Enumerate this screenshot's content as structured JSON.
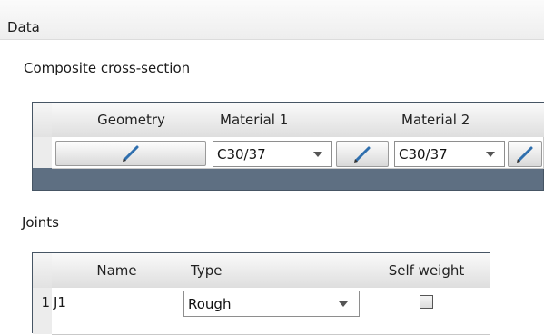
{
  "panel": {
    "title": "Data"
  },
  "composite": {
    "label": "Composite cross-section",
    "headers": {
      "geometry": "Geometry",
      "material1": "Material 1",
      "material2": "Material 2"
    },
    "material1": {
      "value": "C30/37"
    },
    "material2": {
      "value": "C30/37"
    }
  },
  "joints": {
    "label": "Joints",
    "headers": {
      "name": "Name",
      "type": "Type",
      "self_weight": "Self weight"
    },
    "rows": [
      {
        "index": "1",
        "name": "J1",
        "type": "Rough",
        "self_weight": false
      }
    ]
  },
  "colors": {
    "grid_frame": "#5e6f82",
    "pencil_blue": "#2f6fae"
  },
  "icons": [
    "pencil-icon",
    "chevron-down-icon",
    "checkbox-icon"
  ]
}
